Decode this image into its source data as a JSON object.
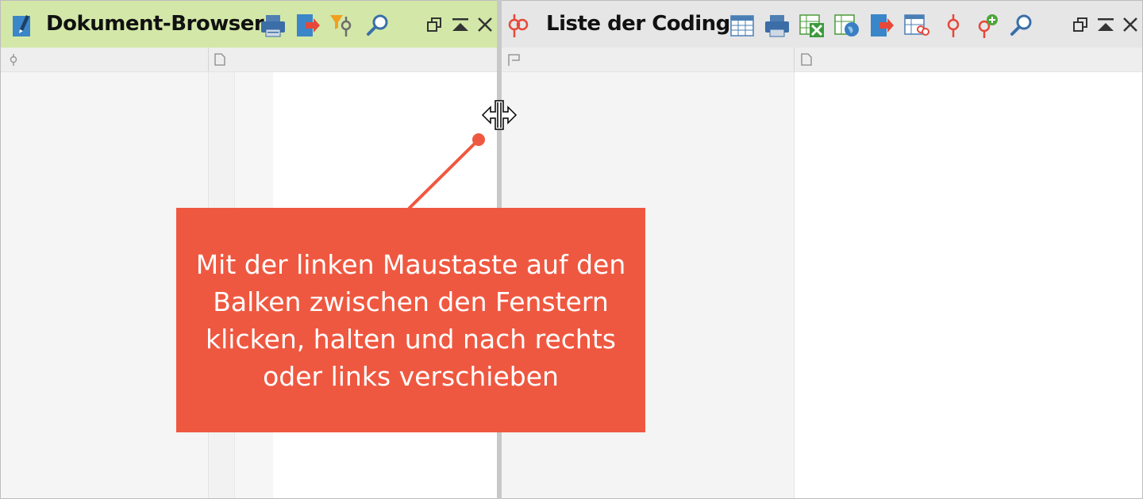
{
  "left_pane": {
    "title": "Dokument-Browser",
    "header_bg": "#d3e8a8",
    "toolbar_icons": [
      "document-pen-icon",
      "print-icon",
      "export-icon",
      "filter-code-icon",
      "search-icon"
    ],
    "window_buttons": [
      "undock-icon",
      "maximize-icon",
      "close-icon"
    ],
    "columns": [
      "code-column-icon",
      "document-column-icon"
    ]
  },
  "right_pane": {
    "title": "Liste der Codings",
    "header_bg": "#e6e6e6",
    "toolbar_icons": [
      "table-icon",
      "print-icon",
      "excel-export-icon",
      "web-export-icon",
      "export-icon",
      "table-codes-icon",
      "code-icon",
      "add-code-icon",
      "search-icon"
    ],
    "window_buttons": [
      "undock-icon",
      "maximize-icon",
      "close-icon"
    ],
    "columns": [
      "flag-column-icon",
      "document-column-icon"
    ]
  },
  "callout": {
    "text": "Mit der linken Maustaste auf den\nBalken zwischen den Fenstern\nklicken, halten und nach rechts\noder links verschieben",
    "color": "#ef5840"
  },
  "cursor": "resize-horizontal-cursor"
}
